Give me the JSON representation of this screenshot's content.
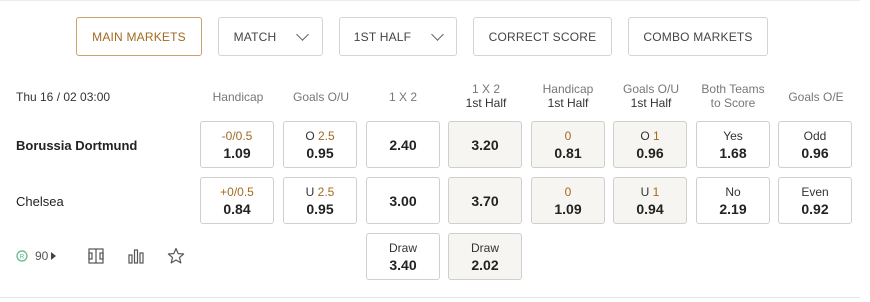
{
  "tabs": [
    {
      "label": "MAIN MARKETS",
      "active": true
    },
    {
      "label": "MATCH",
      "dropdown": true
    },
    {
      "label": "1ST HALF",
      "dropdown": true
    },
    {
      "label": "CORRECT SCORE"
    },
    {
      "label": "COMBO MARKETS"
    }
  ],
  "match": {
    "datetime": "Thu 16 / 02 03:00",
    "home": "Borussia Dortmund",
    "away": "Chelsea",
    "market_count": "90"
  },
  "headers": {
    "handicap": "Handicap",
    "goals_ou": "Goals O/U",
    "one_x_two": "1 X 2",
    "one_x_two_1h": [
      "1 X 2",
      "1st Half"
    ],
    "handicap_1h": [
      "Handicap",
      "1st Half"
    ],
    "goals_ou_1h": [
      "Goals O/U",
      "1st Half"
    ],
    "btts": [
      "Both Teams",
      "to Score"
    ],
    "goals_oe": "Goals O/E"
  },
  "odds": {
    "handicap": [
      {
        "line": "-0/0.5",
        "price": "1.09"
      },
      {
        "line": "+0/0.5",
        "price": "0.84"
      }
    ],
    "goals_ou": [
      {
        "side": "O",
        "line": "2.5",
        "price": "0.95"
      },
      {
        "side": "U",
        "line": "2.5",
        "price": "0.95"
      }
    ],
    "one_x_two": [
      {
        "price": "2.40"
      },
      {
        "price": "3.00"
      },
      {
        "label": "Draw",
        "price": "3.40"
      }
    ],
    "one_x_two_1h": [
      {
        "price": "3.20"
      },
      {
        "price": "3.70"
      },
      {
        "label": "Draw",
        "price": "2.02"
      }
    ],
    "handicap_1h": [
      {
        "line": "0",
        "price": "0.81"
      },
      {
        "line": "0",
        "price": "1.09"
      }
    ],
    "goals_ou_1h": [
      {
        "side": "O",
        "line": "1",
        "price": "0.96"
      },
      {
        "side": "U",
        "line": "1",
        "price": "0.94"
      }
    ],
    "btts": [
      {
        "label": "Yes",
        "price": "1.68"
      },
      {
        "label": "No",
        "price": "2.19"
      }
    ],
    "goals_oe": [
      {
        "label": "Odd",
        "price": "0.96"
      },
      {
        "label": "Even",
        "price": "0.92"
      }
    ]
  },
  "colors": {
    "accent": "#a26a1f",
    "active_border": "#c9a46c",
    "live_green": "#5bb98a"
  },
  "icons": [
    "play-arrow-icon",
    "pitch-icon",
    "stats-bars-icon",
    "star-icon"
  ]
}
